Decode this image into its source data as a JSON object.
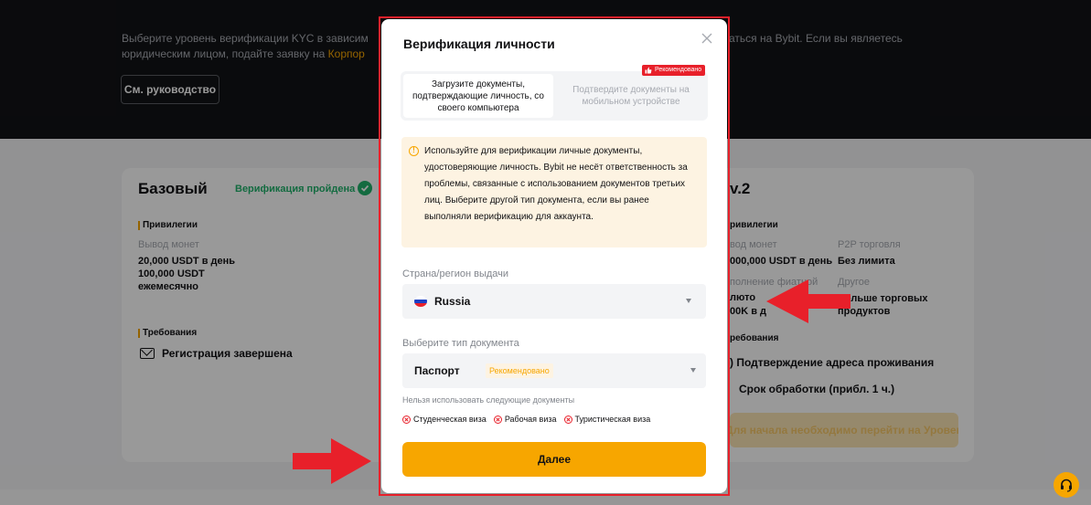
{
  "background": {
    "intro_left_line1": "Выберите уровень верификации KYC в зависим",
    "intro_left_line2": "юридическим лицом, подайте заявку на",
    "intro_left_link": "Корпор",
    "intro_right_line1": "аться на Bybit. Если вы являетесь",
    "guide_button": "См. руководство",
    "basic_card": {
      "title": "Базовый",
      "status": "Верификация пройдена",
      "privileges_label": "Привилегии",
      "withdraw_label": "Вывод монет",
      "withdraw_day": "20,000 USDT в день",
      "withdraw_month_1": "100,000 USDT",
      "withdraw_month_2": "ежемесячно",
      "requirements_label": "Требования",
      "requirement_1": "Регистрация завершена"
    },
    "lv2_card": {
      "title": "v.2",
      "privileges_label": "ривилегии",
      "withdraw_label": "вод монет",
      "withdraw_value": "000,000 USDT в день",
      "p2p_label": "P2P торговля",
      "p2p_value": "Без лимита",
      "fiat_label": "полнение фиатной",
      "fiat_value_1": "люто",
      "fiat_value_2": "00K в д",
      "other_label": "Другое",
      "other_value_1": "Больше торговых",
      "other_value_2": "продуктов",
      "requirements_label": "ребования",
      "requirement_1": ") Подтверждение адреса проживания",
      "requirement_2": "Срок обработки (прибл. 1 ч.)",
      "cta": "Для начала необходимо перейти на Уровен"
    }
  },
  "modal": {
    "title": "Верификация личности",
    "tab_upload": "Загрузите документы, подтверждающие личность, со своего компьютера",
    "tab_mobile": "Подтвердите документы на мобильном устройстве",
    "recommended_badge": "Рекомендовано",
    "notice": "Используйте для верификации личные документы, удостоверяющие личность. Bybit не несёт ответственность за проблемы, связанные с использованием документов третьих лиц. Выберите другой тип документа, если вы ранее выполняли верификацию для аккаунта.",
    "country_label": "Страна/регион выдачи",
    "country_value": "Russia",
    "doc_type_label": "Выберите тип документа",
    "doc_type_value": "Паспорт",
    "doc_type_tag": "Рекомендовано",
    "forbidden_label": "Нельзя использовать следующие документы",
    "forbidden": [
      "Студенческая виза",
      "Рабочая виза",
      "Туристическая виза"
    ],
    "next_button": "Далее"
  },
  "colors": {
    "accent": "#f7a600",
    "highlight_red": "#e8202a",
    "success_green": "#20b26c",
    "header_bg": "#121316"
  },
  "icons": [
    "close-icon",
    "thumbs-up-icon",
    "info-icon",
    "russia-flag-icon",
    "chevron-down-icon",
    "x-circle-icon",
    "check-circle-icon",
    "mail-icon",
    "headset-icon",
    "red-arrow-icon"
  ]
}
